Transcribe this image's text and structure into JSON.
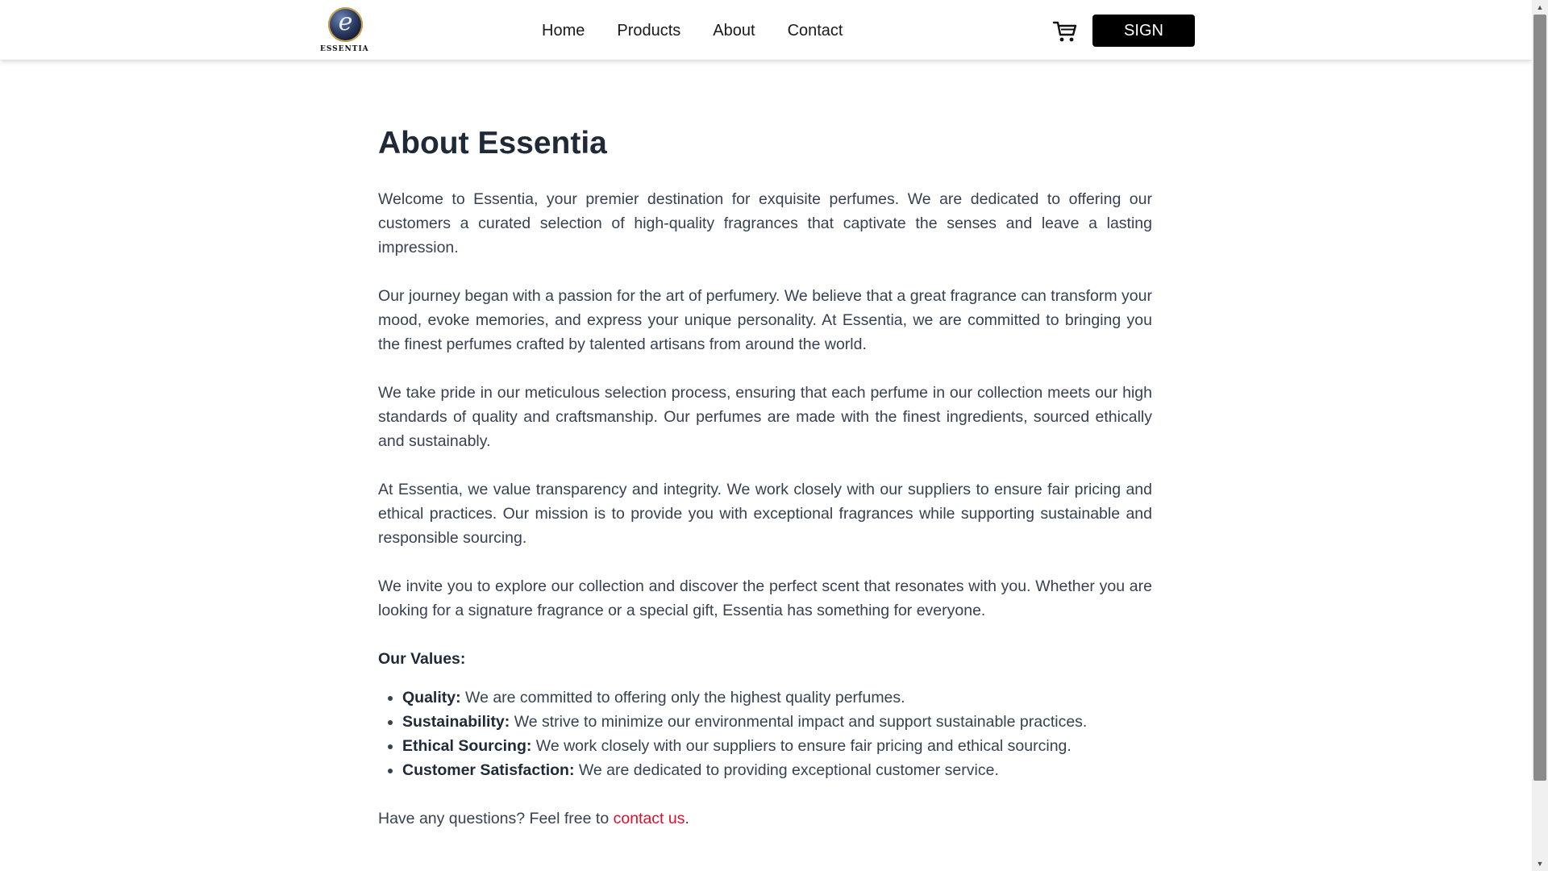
{
  "brand": {
    "name": "ESSENTIA",
    "monogram": "e"
  },
  "nav": {
    "items": [
      {
        "label": "Home"
      },
      {
        "label": "Products"
      },
      {
        "label": "About"
      },
      {
        "label": "Contact"
      }
    ]
  },
  "header": {
    "cart_icon": "shopping-cart-icon",
    "sign_label": "SIGN"
  },
  "about": {
    "title": "About Essentia",
    "paragraphs": [
      "Welcome to Essentia, your premier destination for exquisite perfumes. We are dedicated to offering our customers a curated selection of high-quality fragrances that captivate the senses and leave a lasting impression.",
      "Our journey began with a passion for the art of perfumery. We believe that a great fragrance can transform your mood, evoke memories, and express your unique personality. At Essentia, we are committed to bringing you the finest perfumes crafted by talented artisans from around the world.",
      "We take pride in our meticulous selection process, ensuring that each perfume in our collection meets our high standards of quality and craftsmanship. Our perfumes are made with the finest ingredients, sourced ethically and sustainably.",
      "At Essentia, we value transparency and integrity. We work closely with our suppliers to ensure fair pricing and ethical practices. Our mission is to provide you with exceptional fragrances while supporting sustainable and responsible sourcing.",
      "We invite you to explore our collection and discover the perfect scent that resonates with you. Whether you are looking for a signature fragrance or a special gift, Essentia has something for everyone."
    ],
    "values_heading": "Our Values:",
    "values": [
      {
        "name": "Quality:",
        "text": " We are committed to offering only the highest quality perfumes."
      },
      {
        "name": "Sustainability:",
        "text": " We strive to minimize our environmental impact and support sustainable practices."
      },
      {
        "name": "Ethical Sourcing:",
        "text": " We work closely with our suppliers to ensure fair pricing and ethical sourcing."
      },
      {
        "name": "Customer Satisfaction:",
        "text": " We are dedicated to providing exceptional customer service."
      }
    ],
    "questions_prefix": "Have any questions? Feel free to ",
    "contact_link": "contact us",
    "questions_suffix": "."
  },
  "colors": {
    "link": "#dc0f2b",
    "button_bg": "#000000",
    "heading": "#1f2937"
  }
}
